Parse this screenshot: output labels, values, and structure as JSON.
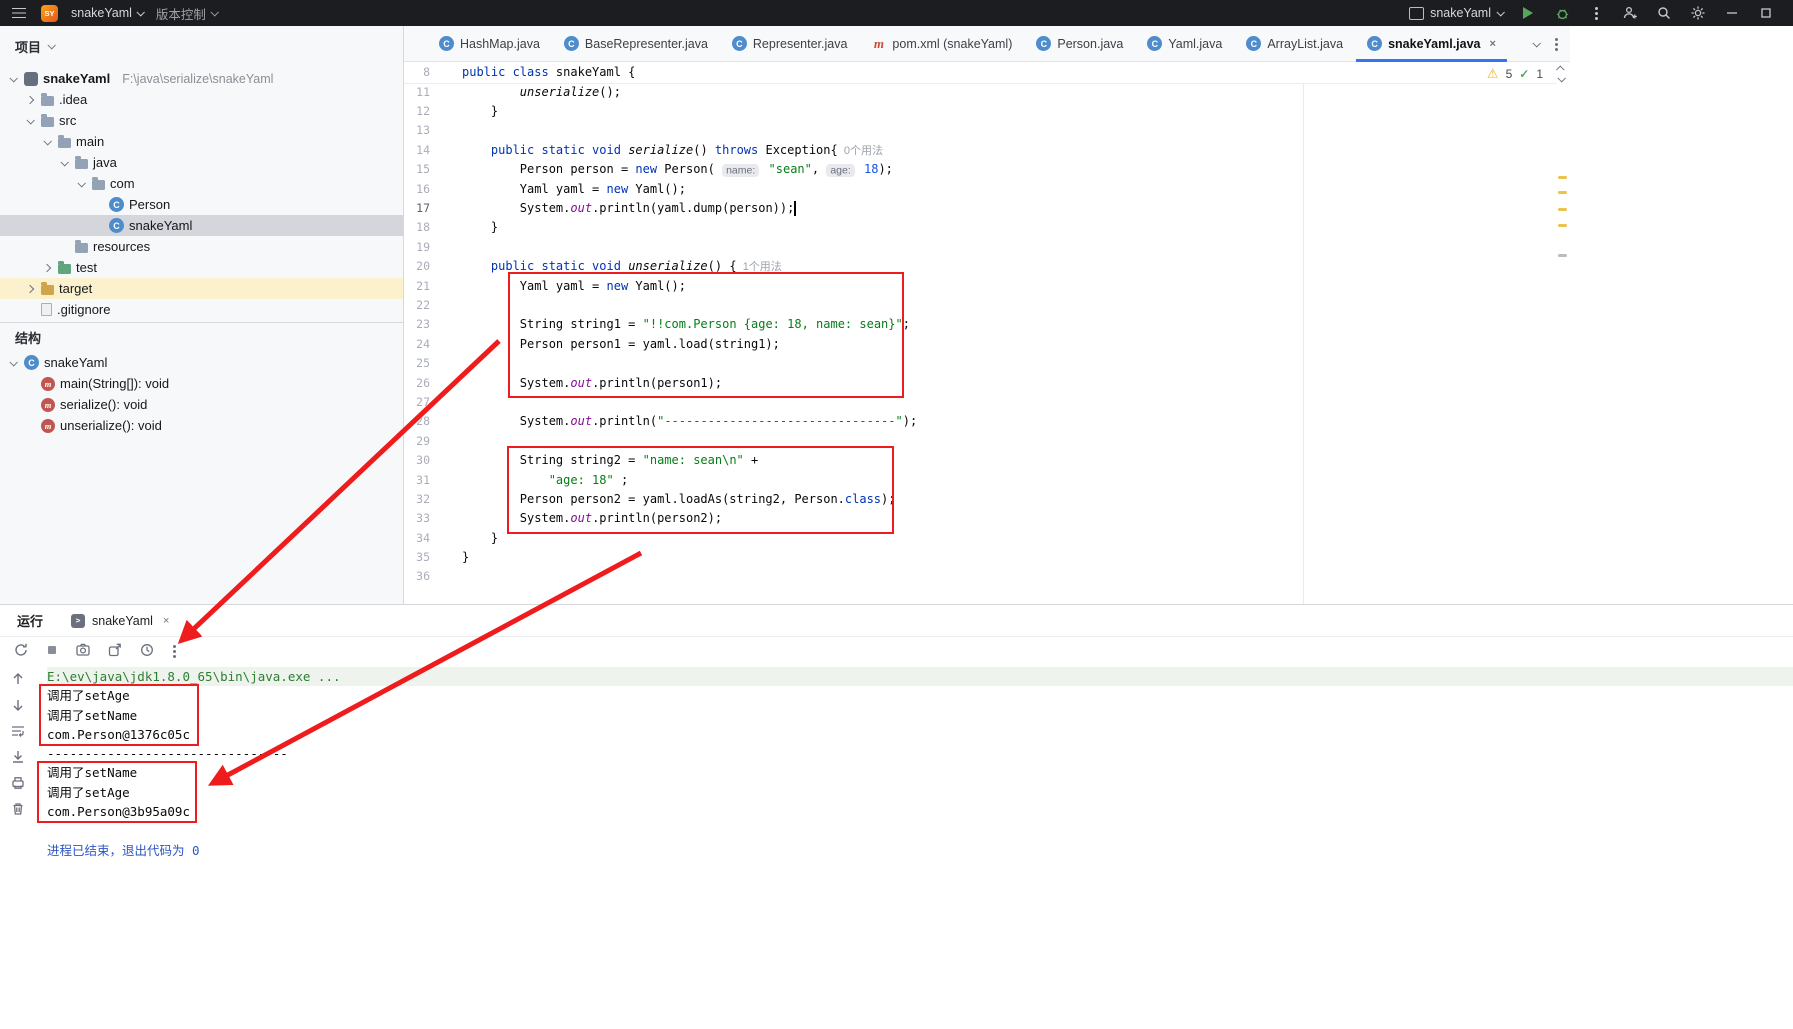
{
  "colors": {
    "accent": "#3574f0",
    "annotation_red": "#ee1c1c",
    "warning_yellow": "#edb41c",
    "success_green": "#59a869"
  },
  "titlebar": {
    "logo": "SY",
    "project_button": "snakeYaml",
    "vcs_button": "版本控制",
    "run_config": "snakeYaml"
  },
  "project": {
    "header": "项目",
    "tree": [
      {
        "label": "snakeYaml",
        "extra": "F:\\java\\serialize\\snakeYaml",
        "level": 0,
        "icon": "project",
        "chev": "v",
        "bold": true
      },
      {
        "label": ".idea",
        "level": 1,
        "icon": "folder",
        "chev": ">"
      },
      {
        "label": "src",
        "level": 1,
        "icon": "folder",
        "chev": "v"
      },
      {
        "label": "main",
        "level": 2,
        "icon": "folder",
        "chev": "v"
      },
      {
        "label": "java",
        "level": 3,
        "icon": "folder",
        "chev": "v"
      },
      {
        "label": "com",
        "level": 4,
        "icon": "package",
        "chev": "v"
      },
      {
        "label": "Person",
        "level": 5,
        "icon": "class"
      },
      {
        "label": "snakeYaml",
        "level": 5,
        "icon": "class",
        "selected": true
      },
      {
        "label": "resources",
        "level": 3,
        "icon": "folder"
      },
      {
        "label": "test",
        "level": 2,
        "icon": "folder-test",
        "chev": ">"
      },
      {
        "label": "target",
        "level": 1,
        "icon": "folder-target",
        "chev": ">",
        "highlight": true
      },
      {
        "label": ".gitignore",
        "level": 1,
        "icon": "file"
      }
    ]
  },
  "structure": {
    "header": "结构",
    "items": [
      {
        "label": "snakeYaml",
        "icon": "class",
        "chev": "v",
        "level": 0
      },
      {
        "label": "main(String[]): void",
        "icon": "method",
        "level": 1
      },
      {
        "label": "serialize(): void",
        "icon": "method",
        "level": 1
      },
      {
        "label": "unserialize(): void",
        "icon": "method",
        "level": 1
      }
    ]
  },
  "editor_tabs": {
    "items": [
      {
        "label": "HashMap.java",
        "icon": "class"
      },
      {
        "label": "BaseRepresenter.java",
        "icon": "class"
      },
      {
        "label": "Representer.java",
        "icon": "class"
      },
      {
        "label": "pom.xml (snakeYaml)",
        "icon": "maven"
      },
      {
        "label": "Person.java",
        "icon": "class"
      },
      {
        "label": "Yaml.java",
        "icon": "class"
      },
      {
        "label": "ArrayList.java",
        "icon": "class"
      },
      {
        "label": "snakeYaml.java",
        "icon": "class",
        "active": true
      }
    ]
  },
  "editor": {
    "inspections": {
      "warnings": "5",
      "ok": "1"
    },
    "sticky": {
      "n": "8",
      "s": [
        [
          "public class ",
          "k"
        ],
        [
          "snakeYaml {",
          ""
        ]
      ]
    },
    "lines": [
      {
        "n": "11",
        "s": [
          [
            "        ",
            ""
          ],
          [
            "unserialize",
            "m"
          ],
          [
            "();",
            ""
          ]
        ]
      },
      {
        "n": "12",
        "s": [
          [
            "    }",
            ""
          ]
        ]
      },
      {
        "n": "13",
        "s": []
      },
      {
        "n": "14",
        "s": [
          [
            "    ",
            ""
          ],
          [
            "public static void ",
            "k"
          ],
          [
            "serialize",
            "m"
          ],
          [
            "() ",
            ""
          ],
          [
            "throws ",
            "k"
          ],
          [
            "Exception{",
            ""
          ],
          [
            "  0个用法",
            "uh"
          ]
        ]
      },
      {
        "n": "15",
        "s": [
          [
            "        Person person = ",
            ""
          ],
          [
            "new ",
            "k"
          ],
          [
            "Person( ",
            ""
          ],
          [
            "name:",
            "ph"
          ],
          [
            " ",
            ""
          ],
          [
            "\"sean\"",
            "s"
          ],
          [
            ", ",
            ""
          ],
          [
            "age:",
            "ph"
          ],
          [
            " ",
            ""
          ],
          [
            "18",
            "n"
          ],
          [
            ");",
            ""
          ]
        ]
      },
      {
        "n": "16",
        "s": [
          [
            "        Yaml yaml = ",
            ""
          ],
          [
            "new ",
            "k"
          ],
          [
            "Yaml();",
            ""
          ]
        ]
      },
      {
        "n": "17",
        "cur": true,
        "s": [
          [
            "        System.",
            ""
          ],
          [
            "out",
            "f"
          ],
          [
            ".println(yaml.dump(person));",
            ""
          ],
          [
            "",
            "caret"
          ]
        ]
      },
      {
        "n": "18",
        "s": [
          [
            "    }",
            ""
          ]
        ]
      },
      {
        "n": "19",
        "s": []
      },
      {
        "n": "20",
        "s": [
          [
            "    ",
            ""
          ],
          [
            "public static void ",
            "k"
          ],
          [
            "unserialize",
            "m"
          ],
          [
            "() {",
            ""
          ],
          [
            "  1个用法",
            "uh"
          ]
        ]
      },
      {
        "n": "21",
        "s": [
          [
            "        Yaml yaml = ",
            ""
          ],
          [
            "new ",
            "k"
          ],
          [
            "Yaml();",
            ""
          ]
        ]
      },
      {
        "n": "22",
        "s": []
      },
      {
        "n": "23",
        "s": [
          [
            "        String string1 = ",
            ""
          ],
          [
            "\"!!com.Person {age: 18, name: sean}\"",
            "s"
          ],
          [
            ";",
            ""
          ]
        ]
      },
      {
        "n": "24",
        "s": [
          [
            "        Person person1 = yaml.load(string1);",
            ""
          ]
        ]
      },
      {
        "n": "25",
        "s": []
      },
      {
        "n": "26",
        "s": [
          [
            "        System.",
            ""
          ],
          [
            "out",
            "f"
          ],
          [
            ".println(person1);",
            ""
          ]
        ]
      },
      {
        "n": "27",
        "s": []
      },
      {
        "n": "28",
        "s": [
          [
            "        System.",
            ""
          ],
          [
            "out",
            "f"
          ],
          [
            ".println(",
            ""
          ],
          [
            "\"--------------------------------\"",
            "s"
          ],
          [
            ");",
            ""
          ]
        ]
      },
      {
        "n": "29",
        "s": []
      },
      {
        "n": "30",
        "s": [
          [
            "        String string2 = ",
            ""
          ],
          [
            "\"name: sean\\n\"",
            "s"
          ],
          [
            " +",
            ""
          ]
        ]
      },
      {
        "n": "31",
        "s": [
          [
            "            ",
            ""
          ],
          [
            "\"age: 18\"",
            "s"
          ],
          [
            " ;",
            ""
          ]
        ]
      },
      {
        "n": "32",
        "s": [
          [
            "        Person person2 = yaml.loadAs(string2, Person.",
            ""
          ],
          [
            "class",
            "k"
          ],
          [
            ");",
            ""
          ]
        ]
      },
      {
        "n": "33",
        "s": [
          [
            "        System.",
            ""
          ],
          [
            "out",
            "f"
          ],
          [
            ".println(person2);",
            ""
          ]
        ]
      },
      {
        "n": "34",
        "s": [
          [
            "    }",
            ""
          ]
        ]
      },
      {
        "n": "35",
        "s": [
          [
            "}",
            ""
          ]
        ]
      },
      {
        "n": "36",
        "s": []
      }
    ]
  },
  "run": {
    "header": "运行",
    "tab": "snakeYaml",
    "console": [
      {
        "c": "cmd",
        "text": "E:\\ev\\java\\jdk1.8.0_65\\bin\\java.exe ..."
      },
      {
        "c": "out",
        "text": "调用了setAge"
      },
      {
        "c": "out",
        "text": "调用了setName"
      },
      {
        "c": "out",
        "text": "com.Person@1376c05c"
      },
      {
        "c": "out",
        "text": "--------------------------------"
      },
      {
        "c": "out",
        "text": "调用了setName"
      },
      {
        "c": "out",
        "text": "调用了setAge"
      },
      {
        "c": "out",
        "text": "com.Person@3b95a09c"
      },
      {
        "c": "out",
        "text": ""
      },
      {
        "c": "exit",
        "text": "进程已结束，退出代码为 0"
      }
    ]
  }
}
